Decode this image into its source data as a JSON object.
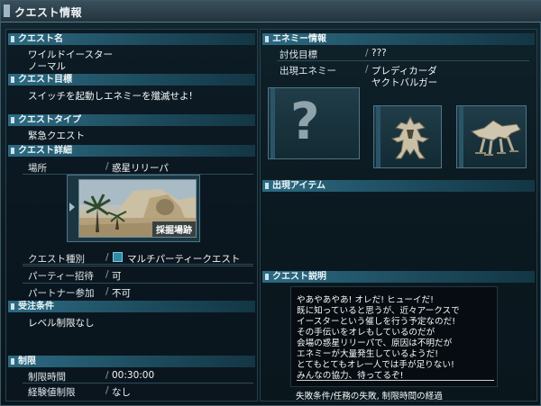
{
  "window": {
    "title": "クエスト情報"
  },
  "left": {
    "quest_name": {
      "header": "クエスト名",
      "line1": "ワイルドイースター",
      "line2": "ノーマル"
    },
    "quest_objective": {
      "header": "クエスト目標",
      "text": "スイッチを起動しエネミーを殲滅せよ!"
    },
    "quest_type": {
      "header": "クエストタイプ",
      "value": "緊急クエスト"
    },
    "quest_detail": {
      "header": "クエスト詳細",
      "location_label": "場所",
      "location_value": "惑星リリーパ",
      "thumbnail_caption": "採掘場跡",
      "category_label": "クエスト種別",
      "category_value": "マルチパーティークエスト",
      "party_label": "パーティー招待",
      "party_value": "可",
      "partner_label": "パートナー参加",
      "partner_value": "不可",
      "slash": "/"
    },
    "conditions": {
      "header": "受注条件",
      "value": "レベル制限なし"
    },
    "limits": {
      "header": "制限",
      "time_label": "制限時間",
      "time_value": "00:30:00",
      "exp_label": "経験値制限",
      "exp_value": "なし"
    }
  },
  "right": {
    "enemy_info": {
      "header": "エネミー情報",
      "target_label": "討伐目標",
      "target_value": "???",
      "appear_label": "出現エネミー",
      "enemy1": "プレディカーダ",
      "enemy2": "ヤクトバルガー",
      "slash": "/",
      "unknown_mark": "?"
    },
    "items": {
      "header": "出現アイテム"
    },
    "description": {
      "header": "クエスト説明",
      "lines": [
        "やあやあやあ! オレだ! ヒューイだ!",
        "既に知っていると思うが、近々アークスで",
        "イースターという催しを行う予定なのだ!",
        "その手伝いをオレもしているのだが",
        "会場の惑星リリーパで、原因は不明だが",
        "エネミーが大量発生しているようだ!",
        "とてもとてもオレ一人では手が足りない!",
        "みんなの協力、待ってるぞ!"
      ],
      "fail_condition": "失敗条件/任務の失敗, 制限時間の経過"
    }
  }
}
